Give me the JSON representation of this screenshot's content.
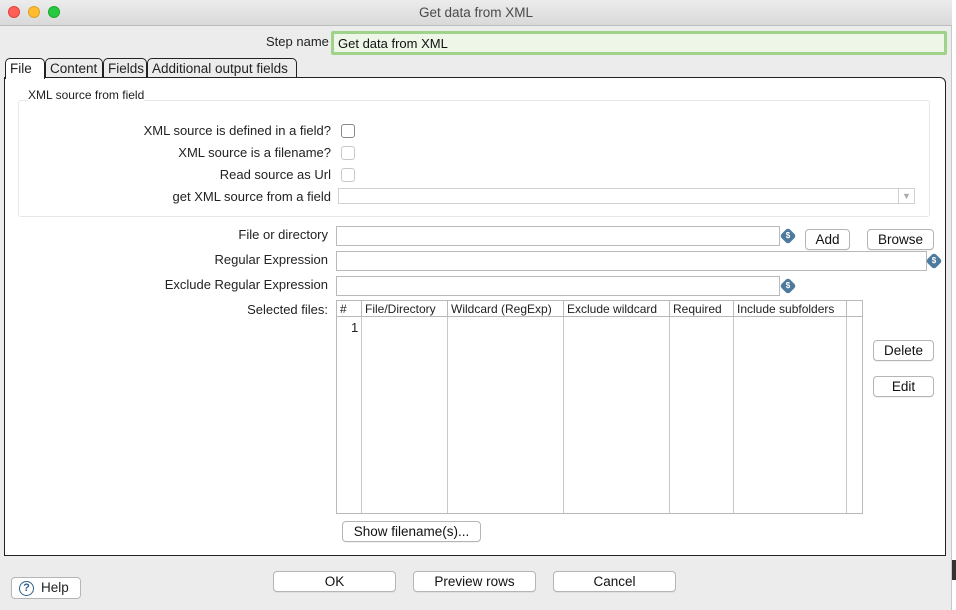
{
  "window": {
    "title": "Get data from XML"
  },
  "step": {
    "label": "Step name",
    "value": "Get data from XML"
  },
  "tabs": [
    {
      "label": "File",
      "active": true
    },
    {
      "label": "Content",
      "active": false
    },
    {
      "label": "Fields",
      "active": false
    },
    {
      "label": "Additional output fields",
      "active": false
    }
  ],
  "source_group": {
    "title": "XML source from field",
    "defined_in_field": {
      "label": "XML source is defined in a field?",
      "checked": false,
      "enabled": true
    },
    "is_filename": {
      "label": "XML source is a filename?",
      "checked": false,
      "enabled": false
    },
    "read_as_url": {
      "label": "Read source as Url",
      "checked": false,
      "enabled": false
    },
    "source_field": {
      "label": "get XML source from a field",
      "value": ""
    }
  },
  "file": {
    "file_or_directory": {
      "label": "File or directory",
      "value": ""
    },
    "regex": {
      "label": "Regular Expression",
      "value": ""
    },
    "exclude_regex": {
      "label": "Exclude Regular Expression",
      "value": ""
    },
    "selected_files_label": "Selected files:",
    "add_label": "Add",
    "browse_label": "Browse",
    "delete_label": "Delete",
    "edit_label": "Edit",
    "show_filenames_label": "Show filename(s)..."
  },
  "table": {
    "columns": [
      "#",
      "File/Directory",
      "Wildcard (RegExp)",
      "Exclude wildcard",
      "Required",
      "Include subfolders"
    ],
    "rows": [
      {
        "num": "1",
        "file": "",
        "wildcard": "",
        "exclude": "",
        "required": "",
        "subfolders": ""
      }
    ]
  },
  "footer": {
    "help_label": "Help",
    "ok_label": "OK",
    "preview_label": "Preview rows",
    "cancel_label": "Cancel"
  },
  "icons": {
    "variable": "dollar-diamond-icon",
    "help": "help-circle-icon"
  },
  "colors": {
    "stepname_border": "#9fd38a",
    "variable_icon": "#4b7a9e"
  }
}
